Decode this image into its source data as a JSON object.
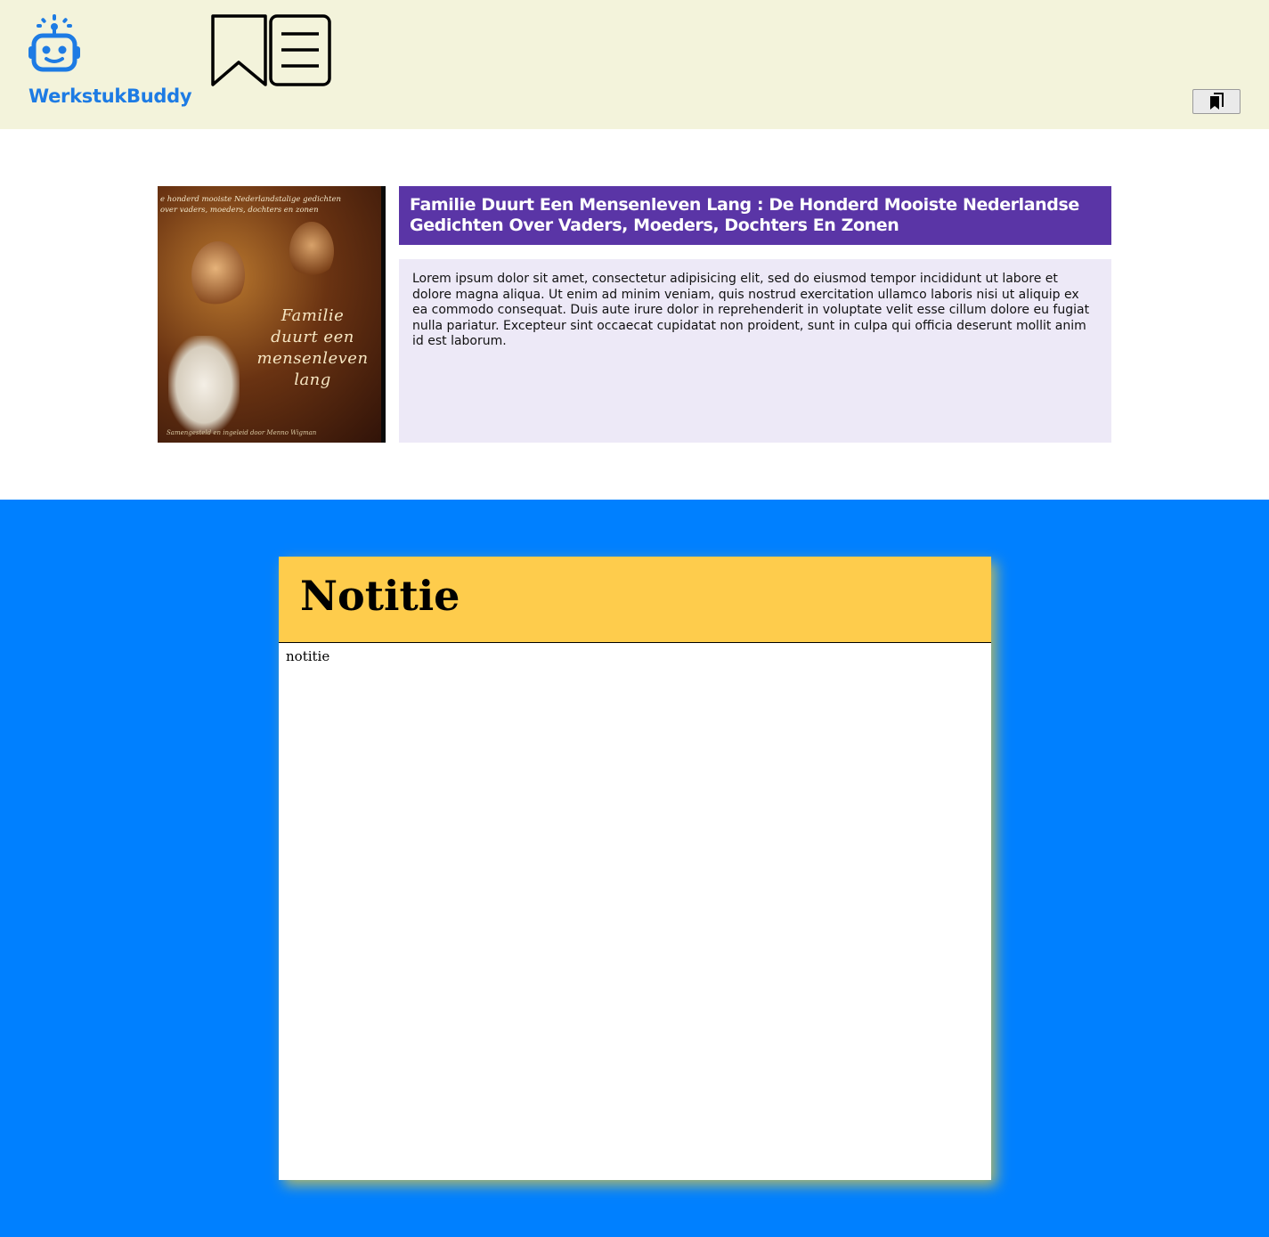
{
  "header": {
    "brand": "WerkstukBuddy",
    "brand_color": "#1d7be4",
    "logo_icon": "robot-icon",
    "book_icon": "book-open-icon",
    "bookmark_icon": "bookmarks-icon"
  },
  "book": {
    "title": "Familie Duurt Een Mensenleven Lang : De Honderd Mooiste Nederlandse Gedichten Over Vaders, Moeders, Dochters En Zonen",
    "description": "Lorem ipsum dolor sit amet, consectetur adipisicing elit, sed do eiusmod tempor incididunt ut labore et dolore magna aliqua. Ut enim ad minim veniam, quis nostrud exercitation ullamco laboris nisi ut aliquip ex ea commodo consequat. Duis aute irure dolor in reprehenderit in voluptate velit esse cillum dolore eu fugiat nulla pariatur. Excepteur sint occaecat cupidatat non proident, sunt in culpa qui officia deserunt mollit anim id est laborum.",
    "cover": {
      "blurb": "e honderd mooiste Nederlandstalige gedichten\nover vaders, moeders, dochters en zonen",
      "title": "Familie\nduurt een\nmensenleven\nlang",
      "credit": "Samengesteld en ingeleid door Menno Wigman"
    },
    "title_bg": "#5a35a6",
    "desc_bg": "#ede9f7"
  },
  "note": {
    "heading": "Notitie",
    "body": "notitie",
    "header_bg": "#fecc4c",
    "section_bg": "#0080ff"
  }
}
